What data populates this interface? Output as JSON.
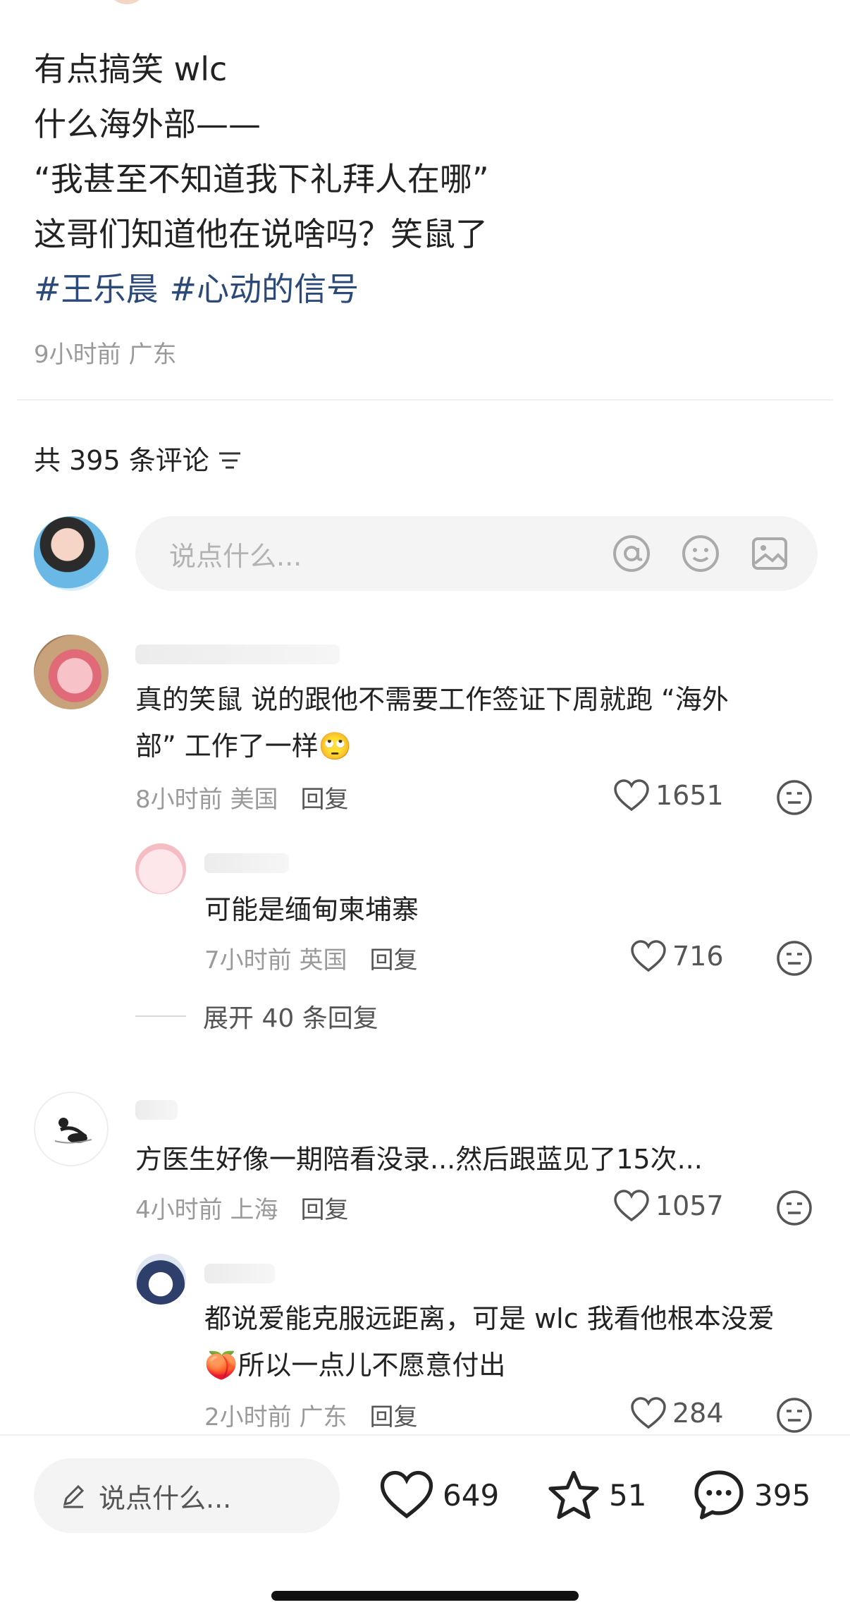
{
  "post": {
    "lines": [
      "有点搞笑 wlc",
      "什么海外部——",
      "“我甚至不知道我下礼拜人在哪”",
      "这哥们知道他在说啥吗？笑鼠了"
    ],
    "tags": [
      "#王乐晨",
      "#心动的信号"
    ],
    "time": "9小时前",
    "location": "广东"
  },
  "comments_header": {
    "prefix": "共",
    "count": "395",
    "suffix": "条评论",
    "filter_icon": "filter-icon"
  },
  "composer": {
    "placeholder": "说点什么...",
    "icons": [
      "at-icon",
      "emoji-icon",
      "image-icon"
    ]
  },
  "comments": [
    {
      "line1": "真的笑鼠 说的跟他不需要工作签证下周就跑 “海外",
      "line2": "部” 工作了一样🙄",
      "time": "8小时前",
      "location": "美国",
      "reply_label": "回复",
      "likes": "1651",
      "replies": [
        {
          "line1": "可能是缅甸柬埔寨",
          "time": "7小时前",
          "location": "英国",
          "reply_label": "回复",
          "likes": "716"
        }
      ],
      "expand_label": "展开 40 条回复"
    },
    {
      "line1": "方医生好像一期陪看没录...然后跟蓝见了15次...",
      "time": "4小时前",
      "location": "上海",
      "reply_label": "回复",
      "likes": "1057",
      "replies": [
        {
          "line1": "都说爱能克服远距离，可是 wlc 我看他根本没爱",
          "line2": "🍑所以一点儿不愿意付出",
          "time": "2小时前",
          "location": "广东",
          "reply_label": "回复",
          "likes": "284"
        }
      ]
    }
  ],
  "bottom_bar": {
    "placeholder": "说点什么...",
    "likes": "649",
    "stars": "51",
    "comments": "395"
  }
}
